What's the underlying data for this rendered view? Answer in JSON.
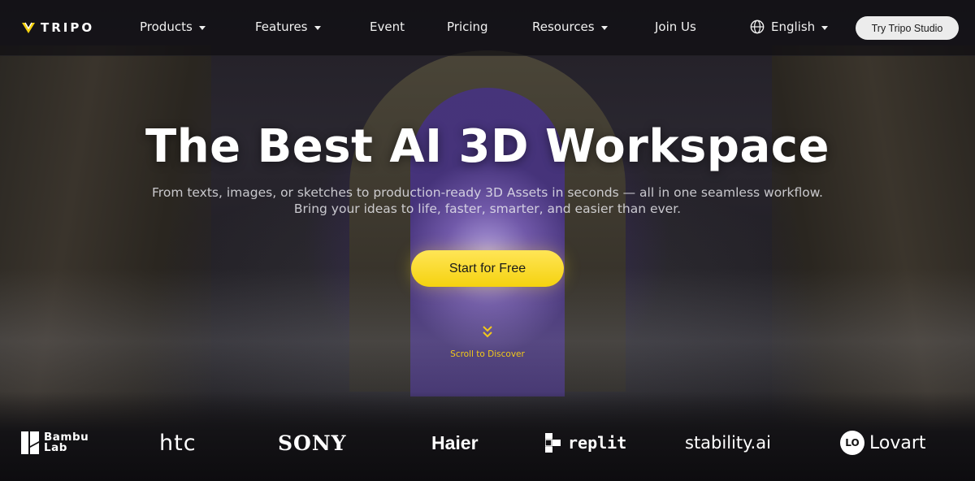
{
  "nav": {
    "logo_text": "TRIPO",
    "items": [
      {
        "label": "Products",
        "dropdown": true
      },
      {
        "label": "Features",
        "dropdown": true
      },
      {
        "label": "Event",
        "dropdown": false
      },
      {
        "label": "Pricing",
        "dropdown": false
      },
      {
        "label": "Resources",
        "dropdown": true
      },
      {
        "label": "Join Us",
        "dropdown": false
      }
    ],
    "language": "English",
    "studio_button": "Try Tripo Studio"
  },
  "hero": {
    "title": "The Best AI 3D Workspace",
    "subtitle_line1": "From texts, images, or sketches to production-ready 3D Assets in seconds — all in one seamless workflow.",
    "subtitle_line2": "Bring your ideas to life, faster, smarter, and easier than ever.",
    "cta_label": "Start for Free",
    "scroll_label": "Scroll to Discover"
  },
  "partners": {
    "bambu_line1": "Bambu",
    "bambu_line2": "Lab",
    "htc": "htc",
    "sony": "SONY",
    "haier": "Haier",
    "replit": "replit",
    "stability": "stability.ai",
    "lovart": "Lovart",
    "lovart_mark": "LO"
  },
  "colors": {
    "accent_yellow": "#f5d20f",
    "scroll_text": "#f3c81a",
    "nav_background": "#0f0e12",
    "studio_button_bg": "#ececec"
  },
  "icons": [
    "tripo-logo-icon",
    "chevron-down-icon",
    "globe-icon",
    "double-chevron-down-icon",
    "bambu-logo-icon",
    "replit-logo-icon",
    "lovart-logo-icon"
  ]
}
